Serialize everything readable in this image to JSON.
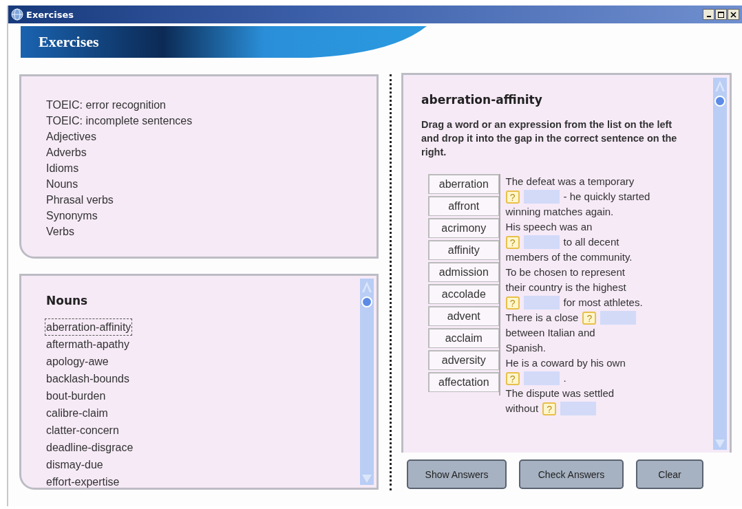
{
  "window": {
    "title": "Exercises"
  },
  "banner": {
    "title": "Exercises"
  },
  "categories": [
    "TOEIC: error recognition",
    "TOEIC: incomplete sentences",
    "Adjectives",
    "Adverbs",
    "Idioms",
    "Nouns",
    "Phrasal verbs",
    "Synonyms",
    "Verbs"
  ],
  "word_list": {
    "title": "Nouns",
    "items": [
      {
        "label": "aberration-affinity",
        "selected": true
      },
      {
        "label": "aftermath-apathy",
        "selected": false
      },
      {
        "label": "apology-awe",
        "selected": false
      },
      {
        "label": "backlash-bounds",
        "selected": false
      },
      {
        "label": "bout-burden",
        "selected": false
      },
      {
        "label": "calibre-claim",
        "selected": false
      },
      {
        "label": "clatter-concern",
        "selected": false
      },
      {
        "label": "deadline-disgrace",
        "selected": false
      },
      {
        "label": "dismay-due",
        "selected": false
      },
      {
        "label": "effort-expertise",
        "selected": false
      }
    ]
  },
  "exercise": {
    "title": "aberration-affinity",
    "instructions": "Drag a word or an expression from the list on the left and drop it into the gap in the correct sentence on the right.",
    "words": [
      "aberration",
      "affront",
      "acrimony",
      "affinity",
      "admission",
      "accolade",
      "advent",
      "acclaim",
      "adversity",
      "affectation"
    ],
    "sentences": [
      {
        "lines": [
          [
            {
              "kind": "text",
              "text": "The defeat was a temporary"
            }
          ],
          [
            {
              "kind": "gap",
              "hint": "?"
            },
            {
              "kind": "text",
              "text": "- he quickly started"
            }
          ],
          [
            {
              "kind": "text",
              "text": "winning matches again."
            }
          ]
        ]
      },
      {
        "lines": [
          [
            {
              "kind": "text",
              "text": "His speech was an"
            }
          ],
          [
            {
              "kind": "gap",
              "hint": "?"
            },
            {
              "kind": "text",
              "text": "to all decent"
            }
          ],
          [
            {
              "kind": "text",
              "text": "members of the community."
            }
          ]
        ]
      },
      {
        "lines": [
          [
            {
              "kind": "text",
              "text": "To be chosen to represent"
            }
          ],
          [
            {
              "kind": "text",
              "text": "their country is the highest"
            }
          ],
          [
            {
              "kind": "gap",
              "hint": "?"
            },
            {
              "kind": "text",
              "text": "for most athletes."
            }
          ]
        ]
      },
      {
        "lines": [
          [
            {
              "kind": "text",
              "text": "There is a close"
            },
            {
              "kind": "gap",
              "hint": "?"
            }
          ],
          [
            {
              "kind": "text",
              "text": "between Italian and"
            }
          ],
          [
            {
              "kind": "text",
              "text": "Spanish."
            }
          ]
        ]
      },
      {
        "lines": [
          [
            {
              "kind": "text",
              "text": "He is a coward by his own"
            }
          ],
          [
            {
              "kind": "gap",
              "hint": "?"
            },
            {
              "kind": "text",
              "text": "."
            }
          ]
        ]
      },
      {
        "lines": [
          [
            {
              "kind": "text",
              "text": "The dispute was settled"
            }
          ],
          [
            {
              "kind": "text",
              "text": "without"
            },
            {
              "kind": "gap",
              "hint": "?"
            }
          ]
        ]
      }
    ]
  },
  "buttons": [
    "Show Answers",
    "Check Answers",
    "Clear"
  ]
}
